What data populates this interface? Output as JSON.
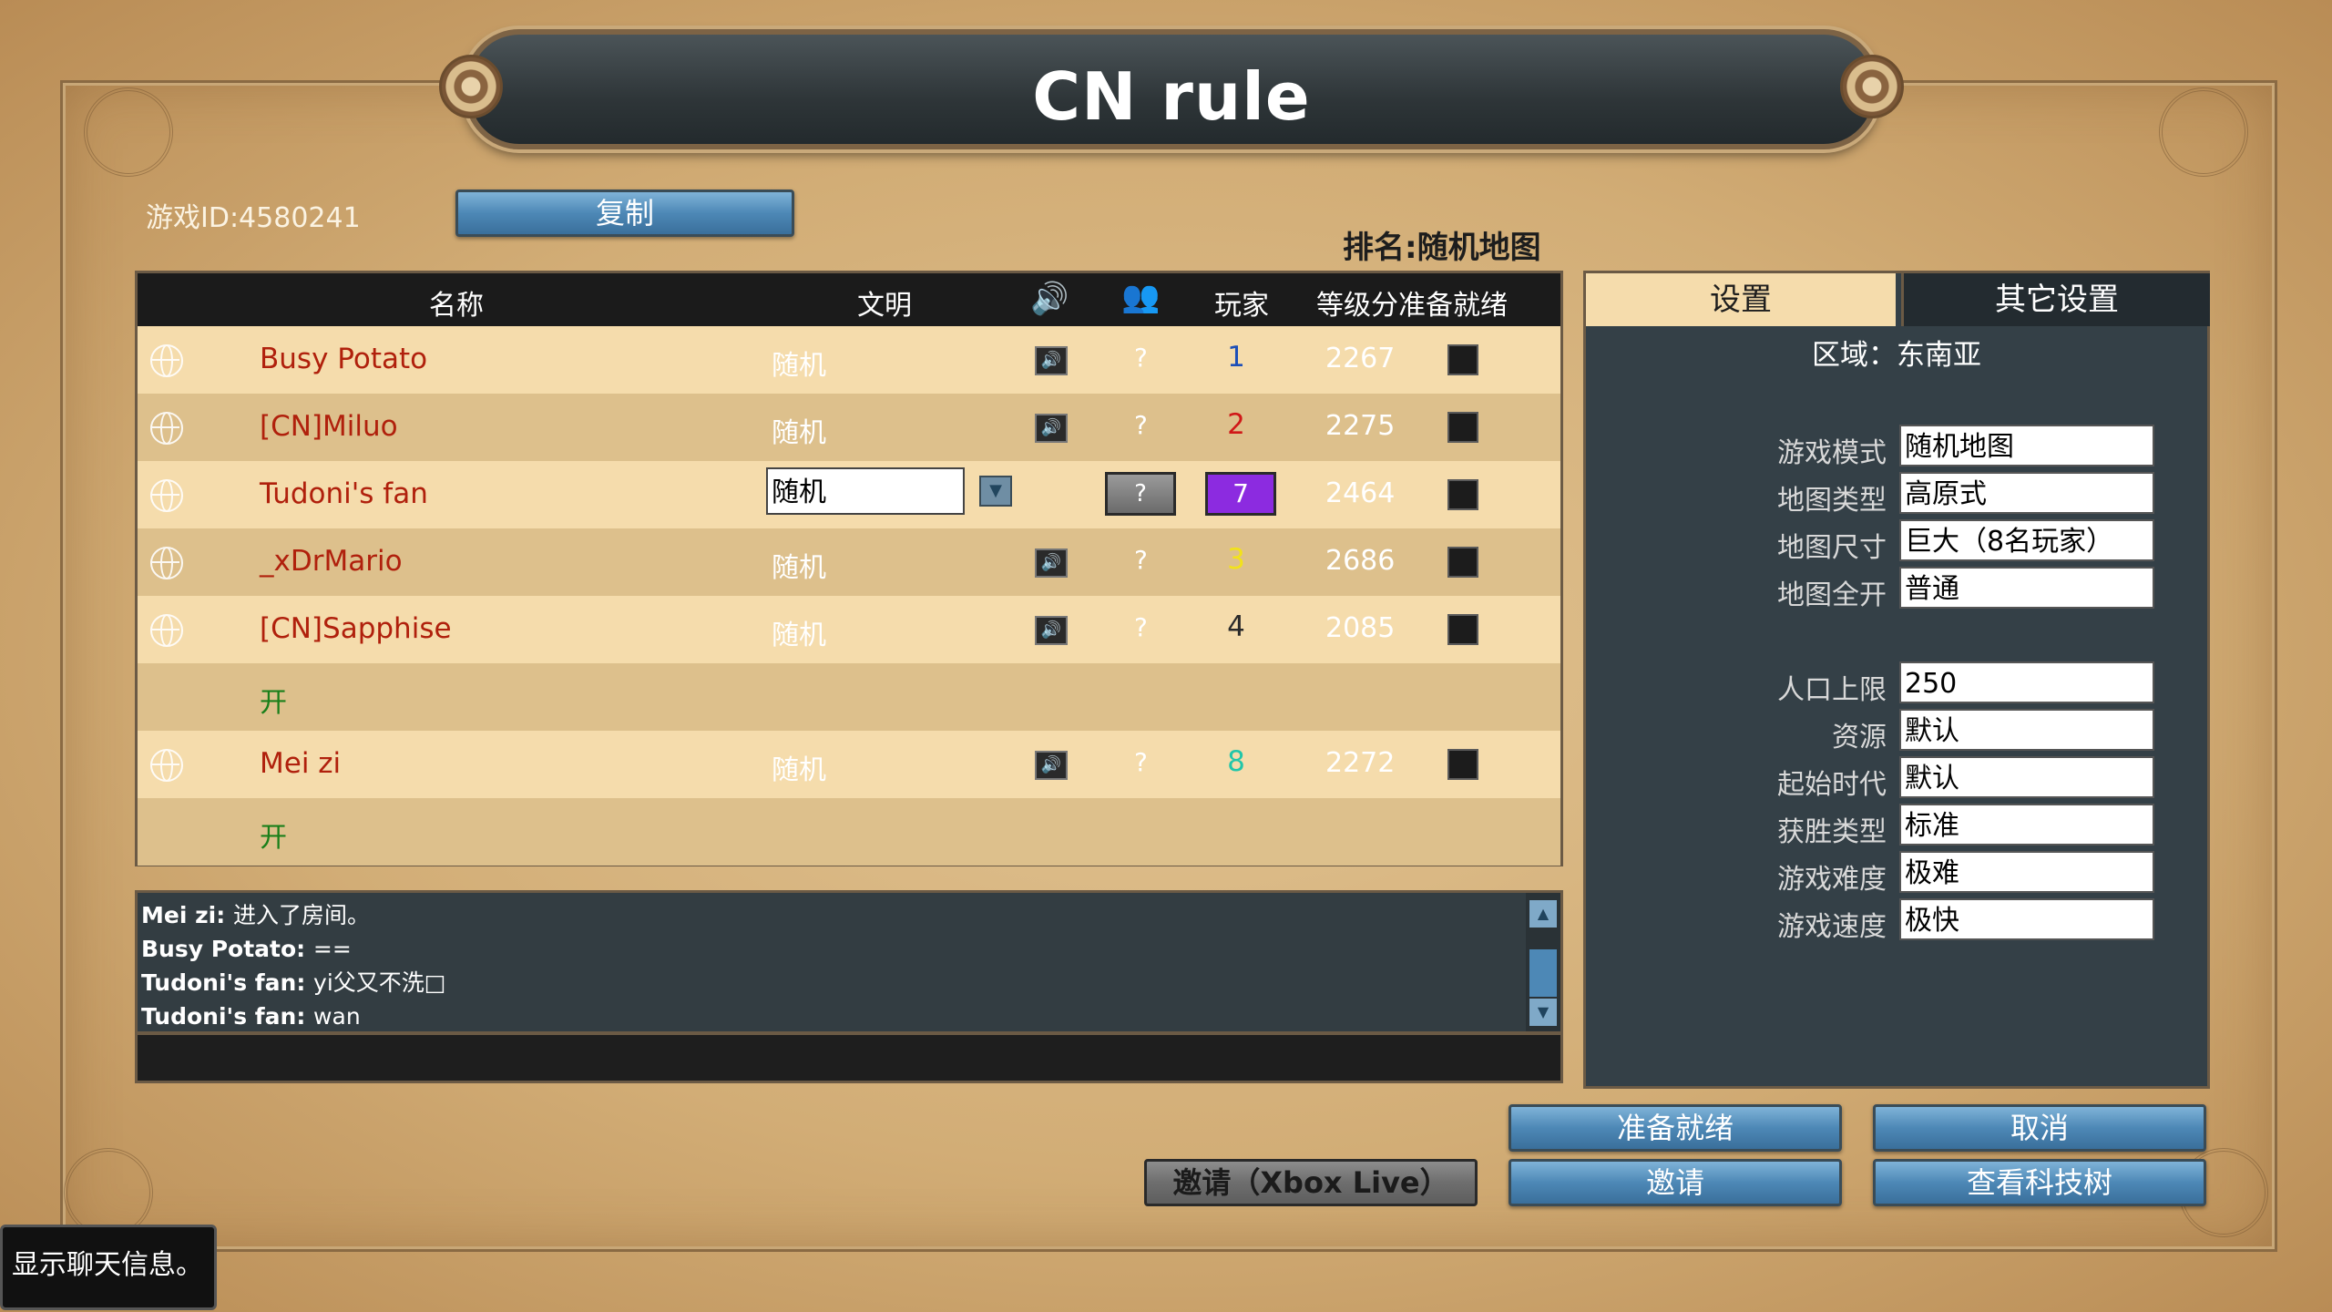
{
  "title": "CN rule",
  "game_id_label": "游戏ID:4580241",
  "copy_button": "复制",
  "ranked_label": "排名:随机地图",
  "table_headers": {
    "name": "名称",
    "civ": "文明",
    "team": "玩家",
    "rating_ready": "等级分准备就绪"
  },
  "players": [
    {
      "type": "player",
      "name": "Busy Potato",
      "civ": "随机",
      "team": "?",
      "number": "1",
      "number_color": "#1d4fb8",
      "rating": "2267"
    },
    {
      "type": "player",
      "name": "[CN]Miluo",
      "civ": "随机",
      "team": "?",
      "number": "2",
      "number_color": "#d01818",
      "rating": "2275"
    },
    {
      "type": "self",
      "name": "Tudoni's fan",
      "civ": "随机",
      "team": "?",
      "number": "7",
      "number_color": "#8c2be0",
      "rating": "2464"
    },
    {
      "type": "player",
      "name": "_xDrMario",
      "civ": "随机",
      "team": "?",
      "number": "3",
      "number_color": "#f2e21a",
      "rating": "2686"
    },
    {
      "type": "player",
      "name": "[CN]Sapphise",
      "civ": "随机",
      "team": "?",
      "number": "4",
      "number_color": "#2a2a2a",
      "rating": "2085"
    },
    {
      "type": "open",
      "label": "开"
    },
    {
      "type": "player",
      "name": "Mei zi",
      "civ": "随机",
      "team": "?",
      "number": "8",
      "number_color": "#21c6a9",
      "rating": "2272"
    },
    {
      "type": "open",
      "label": "开"
    }
  ],
  "chat": [
    {
      "sender": "Mei zi:",
      "text": "进入了房间。"
    },
    {
      "sender": "Busy Potato:",
      "text": "=="
    },
    {
      "sender": "Tudoni's fan:",
      "text": "yi父又不洗□"
    },
    {
      "sender": "Tudoni's fan:",
      "text": "wan"
    }
  ],
  "settings": {
    "tab_settings": "设置",
    "tab_other": "其它设置",
    "region": "区域：东南亚",
    "rows": [
      {
        "label": "游戏模式",
        "value": "随机地图"
      },
      {
        "label": "地图类型",
        "value": "高原式"
      },
      {
        "label": "地图尺寸",
        "value": "巨大（8名玩家）"
      },
      {
        "label": "地图全开",
        "value": "普通"
      },
      {
        "label": "人口上限",
        "value": "250"
      },
      {
        "label": "资源",
        "value": "默认"
      },
      {
        "label": "起始时代",
        "value": "默认"
      },
      {
        "label": "获胜类型",
        "value": "标准"
      },
      {
        "label": "游戏难度",
        "value": "极难"
      },
      {
        "label": "游戏速度",
        "value": "极快"
      }
    ]
  },
  "buttons": {
    "ready": "准备就绪",
    "cancel": "取消",
    "invite_xbox": "邀请（Xbox Live）",
    "invite": "邀请",
    "tech_tree": "查看科技树"
  },
  "tooltip": "显示聊天信息。"
}
